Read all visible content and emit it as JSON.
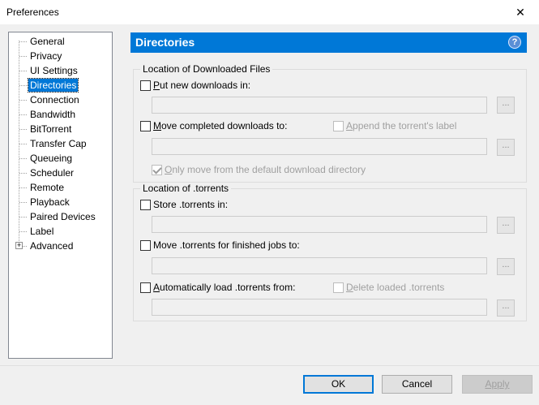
{
  "window": {
    "title": "Preferences",
    "close_glyph": "✕"
  },
  "tree": {
    "items": [
      {
        "label": "General"
      },
      {
        "label": "Privacy"
      },
      {
        "label": "UI Settings"
      },
      {
        "label": "Directories",
        "selected": true
      },
      {
        "label": "Connection"
      },
      {
        "label": "Bandwidth"
      },
      {
        "label": "BitTorrent"
      },
      {
        "label": "Transfer Cap"
      },
      {
        "label": "Queueing"
      },
      {
        "label": "Scheduler"
      },
      {
        "label": "Remote"
      },
      {
        "label": "Playback"
      },
      {
        "label": "Paired Devices"
      },
      {
        "label": "Label"
      },
      {
        "label": "Advanced",
        "expandable": true
      }
    ],
    "expander_glyph": "+"
  },
  "header": {
    "title": "Directories",
    "help_glyph": "?"
  },
  "downloaded": {
    "group_label": "Location of Downloaded Files",
    "put_new": {
      "accel": "P",
      "rest": "ut new downloads in:",
      "checked": false,
      "value": ""
    },
    "move_completed": {
      "accel": "M",
      "rest": "ove completed downloads to:",
      "checked": false,
      "value": ""
    },
    "append_label": {
      "accel": "A",
      "rest": "ppend the torrent's label",
      "enabled": false
    },
    "only_move": {
      "accel": "O",
      "rest": "nly move from the default download directory",
      "checked": true,
      "enabled": false
    }
  },
  "torrents": {
    "group_label": "Location of .torrents",
    "store": {
      "label": "Store .torrents in:",
      "checked": false,
      "value": ""
    },
    "move_finished": {
      "label": "Move .torrents for finished jobs to:",
      "checked": false,
      "value": ""
    },
    "auto_load": {
      "accel": "A",
      "rest": "utomatically load .torrents from:",
      "checked": false,
      "value": ""
    },
    "delete_loaded": {
      "accel": "D",
      "rest": "elete loaded .torrents",
      "enabled": false
    }
  },
  "browse_label": "...",
  "buttons": {
    "ok": "OK",
    "cancel": "Cancel",
    "apply": "Apply",
    "apply_enabled": false
  }
}
